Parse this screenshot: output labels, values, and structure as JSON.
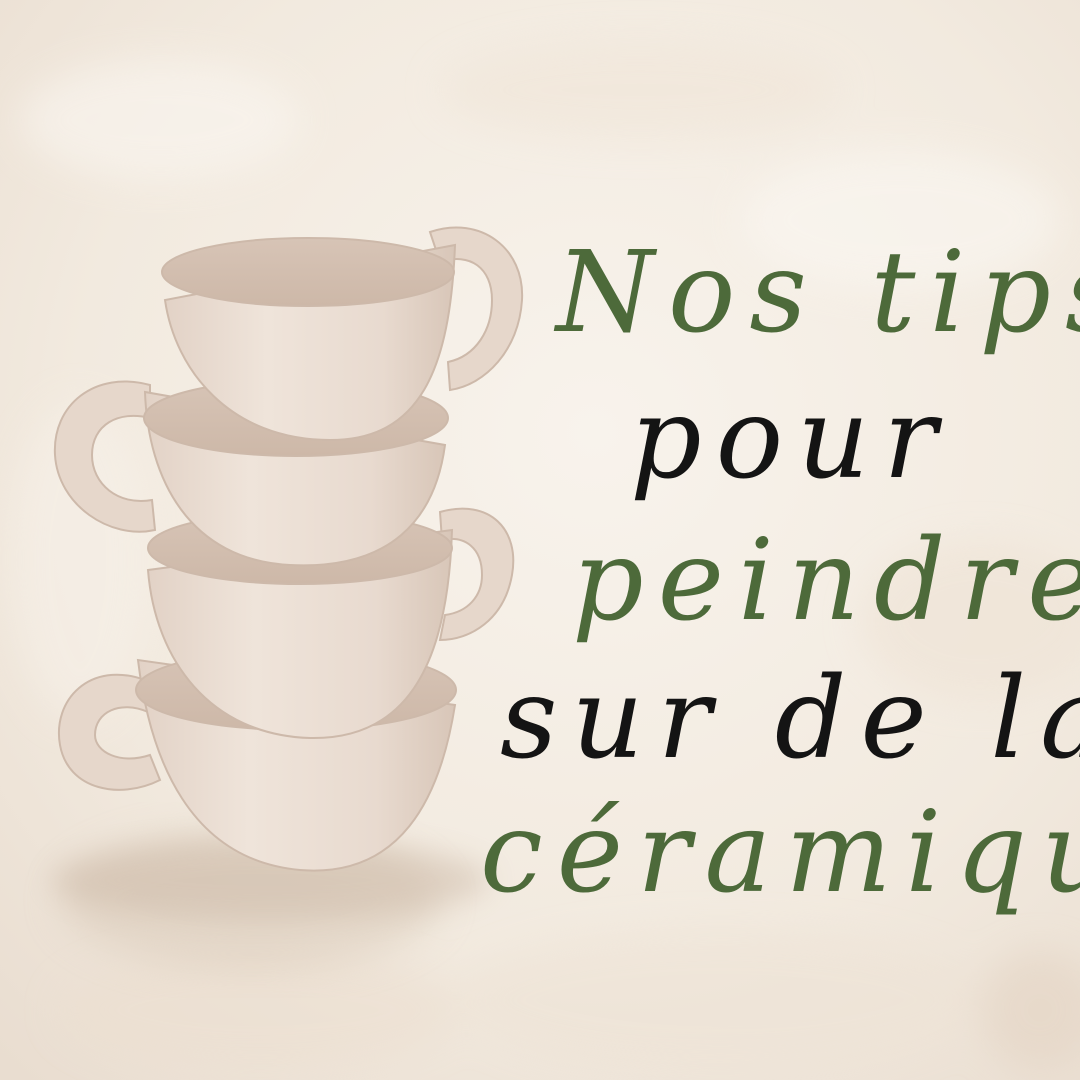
{
  "headline": {
    "line1": "Nos tips",
    "line2": "pour",
    "line3": "peindre",
    "line4": "sur de la",
    "line5": "céramique"
  },
  "colors": {
    "background": "#f3ece3",
    "green_text": "#4d6a3a",
    "black_text": "#141414",
    "ceramic": "#e9dcd2"
  },
  "image": {
    "subject": "stack-of-handmade-ceramic-cups"
  }
}
